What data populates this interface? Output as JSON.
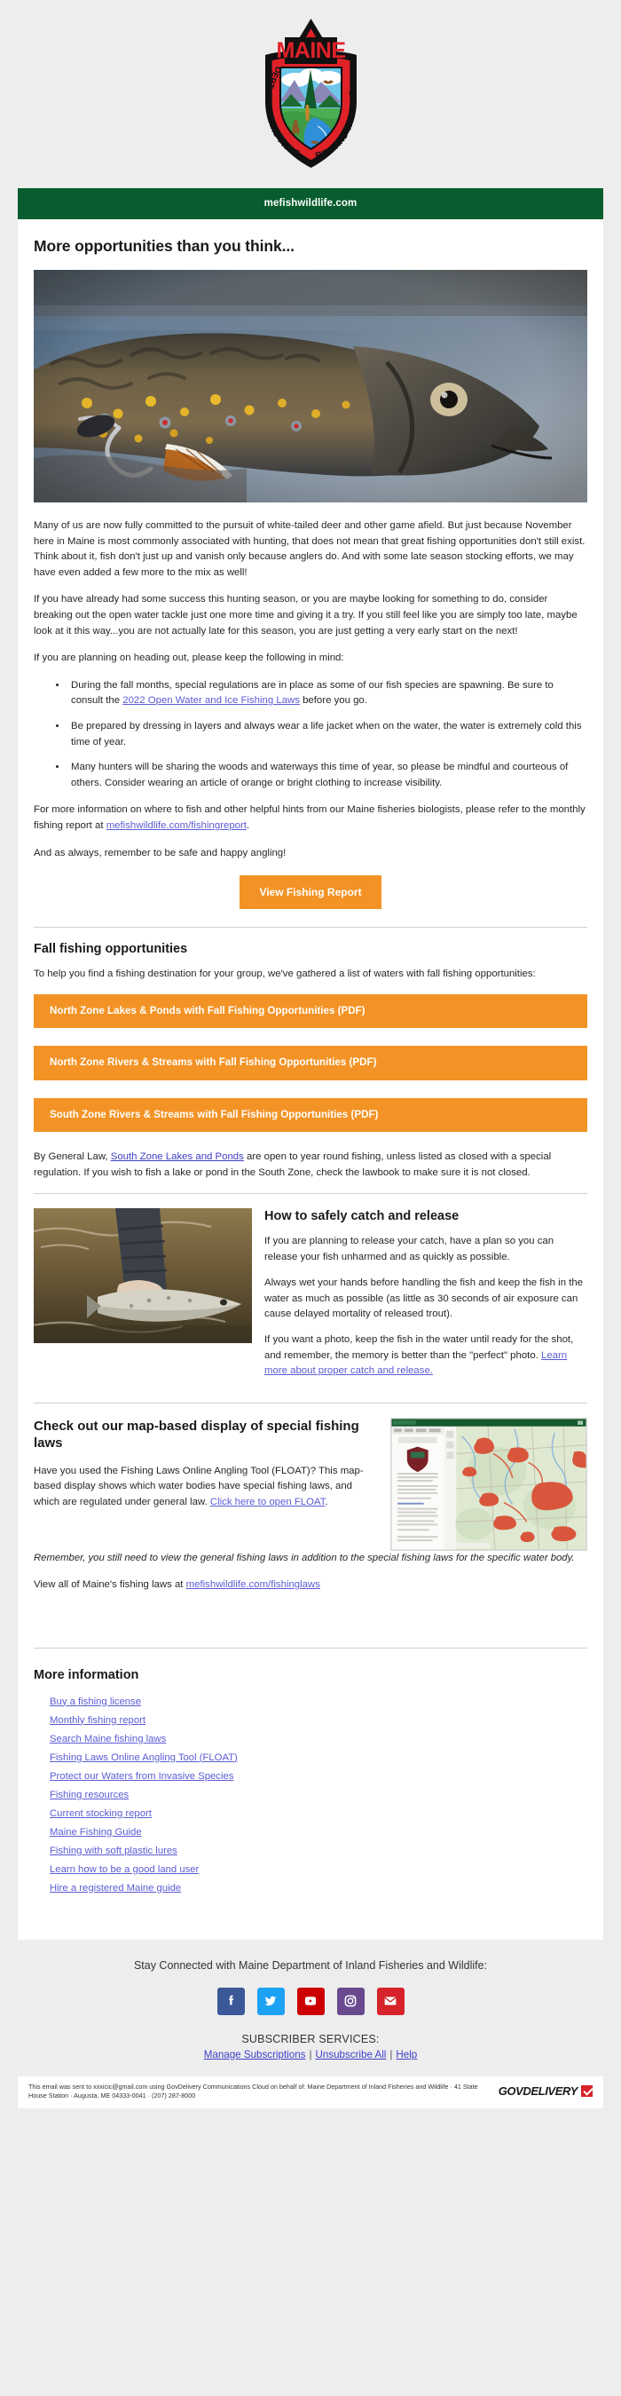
{
  "logo": {
    "alt": "Maine Department of Inland Fisheries and Wildlife shield logo",
    "top_text": "MAINE",
    "arc_text": "DEPT. OF INLAND FISHERIES AND WILDLIFE"
  },
  "header": {
    "site_url": "mefishwildlife.com"
  },
  "headline": "More opportunities than you think...",
  "hero": {
    "alt": "Close-up of a brook trout held in hand with a fly hook"
  },
  "body": {
    "p1": "Many of us are now fully committed to the pursuit of white-tailed deer and other game afield. But just because November here in Maine is most commonly associated with hunting, that does not mean that great fishing opportunities don't still exist. Think about it, fish don't just up and vanish only because anglers do. And with some late season stocking efforts, we may have even added a few more to the mix as well!",
    "p2": "If you have already had some success this hunting season, or you are maybe looking for something to do, consider breaking out the open water tackle just one more time and giving it a try. If you still feel like you are simply too late, maybe look at it this way...you are not actually late for this season, you are just getting a very early start on the next!",
    "p3": "If you are planning on heading out, please keep the following in mind:",
    "bullets": [
      {
        "pre": "During the fall months, special regulations are in place as some of our fish species are spawning. Be sure to consult the ",
        "link": "2022 Open Water and Ice Fishing Laws",
        "post": " before you go."
      },
      {
        "pre": "Be prepared by dressing in layers and always wear a life jacket when on the water, the water is extremely cold this time of year.",
        "link": "",
        "post": ""
      },
      {
        "pre": "Many hunters will be sharing the woods and waterways this time of year, so please be mindful and courteous of others. Consider wearing an article of orange or bright clothing to increase visibility.",
        "link": "",
        "post": ""
      }
    ],
    "p4_pre": "For more information on where to fish and other helpful hints from our Maine fisheries biologists, please refer to the monthly fishing report at ",
    "p4_link": "mefishwildlife.com/fishingreport",
    "p4_post": ".",
    "p5": "And as always, remember to be safe and happy angling!"
  },
  "cta": {
    "view_fishing_report": "View Fishing Report"
  },
  "fall": {
    "heading": "Fall fishing opportunities",
    "intro": "To help you find a fishing destination for your group, we've gathered a list of waters with fall fishing opportunities:",
    "buttons": [
      "North Zone Lakes & Ponds with Fall Fishing Opportunities (PDF)",
      "North Zone Rivers & Streams with Fall Fishing Opportunities (PDF)",
      "South Zone Rivers & Streams with Fall Fishing Opportunities (PDF)"
    ],
    "note_pre": "By General Law, ",
    "note_link": "South Zone Lakes and Ponds",
    "note_post": " are open to year round fishing, unless listed as closed with a special regulation. If you wish to fish a lake or pond in the South Zone, check the lawbook to make sure it is not closed."
  },
  "release": {
    "image_alt": "Angler in waders releasing a fish back into the water",
    "heading": "How to safely catch and release",
    "p1": "If you are planning to release your catch, have a plan so you can release your fish unharmed and as quickly as possible.",
    "p2": "Always wet your hands before handling the fish and keep the fish in the water as much as possible (as little as 30 seconds of air exposure can cause delayed mortality of released trout).",
    "p3_pre": "If you want a photo, keep the fish in the water until ready for the shot, and remember, the memory is better than the \"perfect\" photo. ",
    "p3_link": "Learn more about proper catch and release.",
    "p3_post": ""
  },
  "float": {
    "heading": "Check out our map-based display of special fishing laws",
    "p1_pre": "Have you used the Fishing Laws Online Angling Tool (FLOAT)? This map-based display shows which water bodies have special fishing laws, and which are regulated under general law. ",
    "p1_link": "Click here to open FLOAT",
    "p1_post": ".",
    "italic": "Remember, you still need to view the general fishing laws in addition to the special fishing laws for the specific water body.",
    "p2_pre": "View all of Maine's fishing laws at ",
    "p2_link": "mefishwildlife.com/fishinglaws",
    "p2_post": "",
    "image_alt": "Screenshot of the FLOAT map-based fishing laws tool showing a green terrain map with red highlighted water bodies"
  },
  "more_info": {
    "heading": "More information",
    "links": [
      "Buy a fishing license",
      "Monthly fishing report",
      "Search Maine fishing laws",
      "Fishing Laws Online Angling Tool (FLOAT)",
      "Protect our Waters from Invasive Species",
      "Fishing resources",
      "Current stocking report",
      "Maine Fishing Guide",
      "Fishing with soft plastic lures",
      "Learn how to be a good land user",
      "Hire a registered Maine guide"
    ]
  },
  "footer": {
    "stay_connected": "Stay Connected with Maine Department of Inland Fisheries and Wildlife:",
    "social": [
      {
        "name": "facebook-icon",
        "color": "#3b5998"
      },
      {
        "name": "twitter-icon",
        "color": "#1da1f2"
      },
      {
        "name": "youtube-icon",
        "color": "#cc0000"
      },
      {
        "name": "instagram-icon",
        "color": "#6a4a8f"
      },
      {
        "name": "email-icon",
        "color": "#d6232b"
      }
    ],
    "subscriber_services": "SUBSCRIBER SERVICES:",
    "manage": "Manage Subscriptions",
    "unsubscribe": "Unsubscribe All",
    "help": "Help",
    "separator": "|",
    "disclaimer": "This email was sent to xxxicic@gmail.com using GovDelivery Communications Cloud on behalf of: Maine Department of Inland Fisheries and Wildlife · 41 State House Station · Augusta, ME 04333-0041 · (207) 287-8000",
    "govdelivery": "GOVDELIVERY"
  },
  "colors": {
    "green": "#075d2d",
    "orange": "#f39325",
    "link": "#5b5bd6",
    "page_bg": "#ededed"
  }
}
